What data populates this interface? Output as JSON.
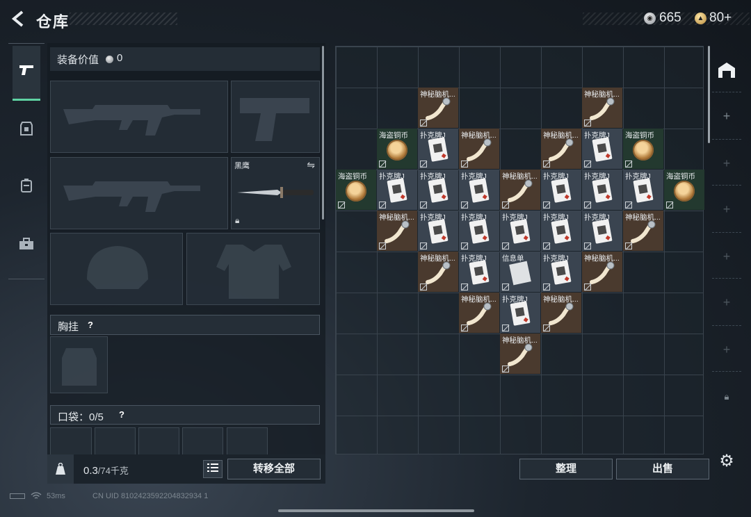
{
  "header": {
    "title": "仓库"
  },
  "currency": {
    "silver": "665",
    "gold": "80+"
  },
  "equipment": {
    "value_label": "装备价值",
    "value": "0",
    "melee_label": "黑鹰",
    "chest_label": "胸挂",
    "pocket_label": "口袋：0/5",
    "help": "?"
  },
  "weight": {
    "current": "0.3",
    "max": "/74千克"
  },
  "buttons": {
    "transfer_all": "转移全部",
    "sort": "整理",
    "sell": "出售"
  },
  "status": {
    "ping": "53ms",
    "uid": "CN UID 8102423592204832934 1"
  },
  "items": {
    "coin": "海盗铜币",
    "card": "扑克牌J",
    "brain": "神秘脑机...",
    "paper": "信息单"
  },
  "grid_cells": [
    {
      "type": "brain",
      "row": 1,
      "col": 2
    },
    {
      "type": "brain",
      "row": 1,
      "col": 6
    },
    {
      "type": "coin",
      "row": 2,
      "col": 1
    },
    {
      "type": "card",
      "row": 2,
      "col": 2
    },
    {
      "type": "brain",
      "row": 2,
      "col": 3
    },
    {
      "type": "brain",
      "row": 2,
      "col": 5
    },
    {
      "type": "card",
      "row": 2,
      "col": 6
    },
    {
      "type": "coin",
      "row": 2,
      "col": 7
    },
    {
      "type": "coin",
      "row": 3,
      "col": 0
    },
    {
      "type": "card",
      "row": 3,
      "col": 1
    },
    {
      "type": "card",
      "row": 3,
      "col": 2
    },
    {
      "type": "card",
      "row": 3,
      "col": 3
    },
    {
      "type": "brain",
      "row": 3,
      "col": 4
    },
    {
      "type": "card",
      "row": 3,
      "col": 5
    },
    {
      "type": "card",
      "row": 3,
      "col": 6
    },
    {
      "type": "card",
      "row": 3,
      "col": 7
    },
    {
      "type": "coin",
      "row": 3,
      "col": 8
    },
    {
      "type": "brain",
      "row": 4,
      "col": 1
    },
    {
      "type": "card",
      "row": 4,
      "col": 2
    },
    {
      "type": "card",
      "row": 4,
      "col": 3
    },
    {
      "type": "card",
      "row": 4,
      "col": 4
    },
    {
      "type": "card",
      "row": 4,
      "col": 5
    },
    {
      "type": "card",
      "row": 4,
      "col": 6
    },
    {
      "type": "brain",
      "row": 4,
      "col": 7
    },
    {
      "type": "brain",
      "row": 5,
      "col": 2
    },
    {
      "type": "card",
      "row": 5,
      "col": 3
    },
    {
      "type": "paper",
      "row": 5,
      "col": 4
    },
    {
      "type": "card",
      "row": 5,
      "col": 5
    },
    {
      "type": "brain",
      "row": 5,
      "col": 6
    },
    {
      "type": "brain",
      "row": 6,
      "col": 3
    },
    {
      "type": "card",
      "row": 6,
      "col": 4
    },
    {
      "type": "brain",
      "row": 6,
      "col": 5
    },
    {
      "type": "brain",
      "row": 7,
      "col": 4
    }
  ]
}
